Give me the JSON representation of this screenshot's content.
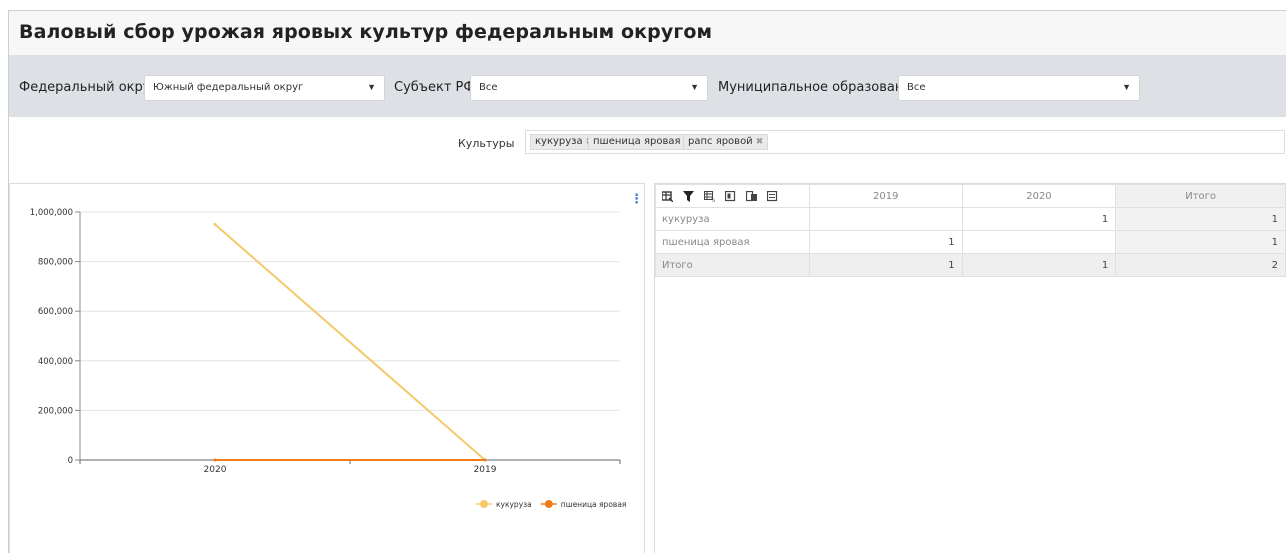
{
  "page": {
    "title": "Валовый сбор урожая яровых культур федеральным округом"
  },
  "filters": {
    "okrug_label": "Федеральный округ",
    "okrug_value": "Южный федеральный округ",
    "subject_label": "Субъект РФ",
    "subject_value": "Все",
    "municipal_label": "Муниципальное образование",
    "municipal_value": "Все",
    "cultures_label": "Культуры",
    "cultures": [
      "кукуруза",
      "пшеница яровая",
      "рапс яровой"
    ]
  },
  "chart_data": {
    "type": "line",
    "categories": [
      "2020",
      "2019"
    ],
    "ylim": [
      0,
      1000000
    ],
    "yticks": [
      "1,000,000",
      "800,000",
      "600,000",
      "400,000",
      "200,000",
      "0"
    ],
    "series": [
      {
        "name": "кукуруза",
        "values": [
          950000,
          0
        ],
        "color": "#f5c96a"
      },
      {
        "name": "пшеница яровая",
        "values": [
          0,
          0
        ],
        "color": "#f07c1e"
      }
    ],
    "legend_position": "bottom-right",
    "grid": true
  },
  "pivot": {
    "columns": [
      "2019",
      "2020",
      "Итого"
    ],
    "rows": [
      {
        "label": "кукуруза",
        "values": [
          "",
          "1",
          "1"
        ]
      },
      {
        "label": "пшеница яровая",
        "values": [
          "1",
          "",
          "1"
        ]
      },
      {
        "label": "Итого",
        "values": [
          "1",
          "1",
          "2"
        ]
      }
    ],
    "toolbar_icons": [
      "fields-icon",
      "filter-icon",
      "format-icon",
      "expand-icon",
      "copy-icon",
      "export-icon"
    ]
  }
}
